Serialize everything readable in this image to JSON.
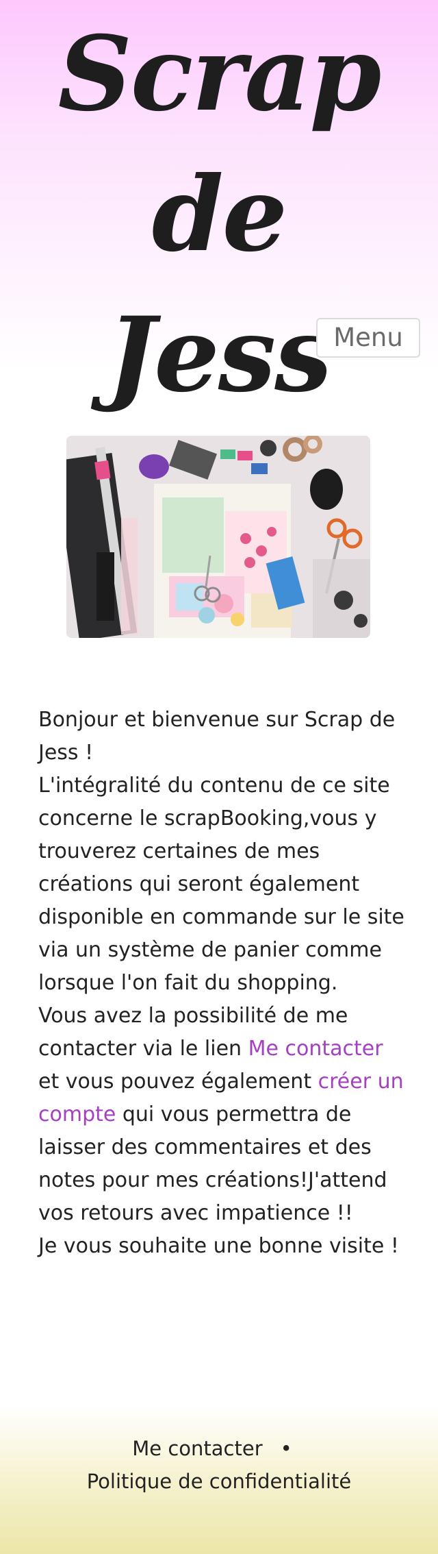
{
  "header": {
    "site_title_line1": "Scrap de",
    "site_title_line2": "Jess",
    "menu_label": "Menu"
  },
  "hero": {
    "image_description_icon": "scrapbooking-tools-photo"
  },
  "content": {
    "p1": "Bonjour et bienvenue sur Scrap de Jess !",
    "p2": "L'intégralité du contenu de ce site concerne le scrapBooking,vous y trouverez certaines de mes créations qui seront également disponible en commande sur le site via un système de panier comme lorsque l'on fait du shopping.",
    "p3_before": "Vous avez la possibilité de me contacter via le lien ",
    "p3_link1": "Me contacter",
    "p3_middle": " et vous pouvez également ",
    "p3_link2": "créer un compte",
    "p3_after": " qui vous permettra de laisser des commentaires et des notes pour mes créations!J'attend vos retours avec impatience !!",
    "p4": "Je vous souhaite une bonne visite !"
  },
  "footer": {
    "contact_link": "Me contacter",
    "separator": "•",
    "privacy_link": "Politique de confidentialité"
  },
  "colors": {
    "header_pink": "#fdc8fd",
    "link_purple": "#a63fc2",
    "footer_yellow": "#ece6a8"
  }
}
